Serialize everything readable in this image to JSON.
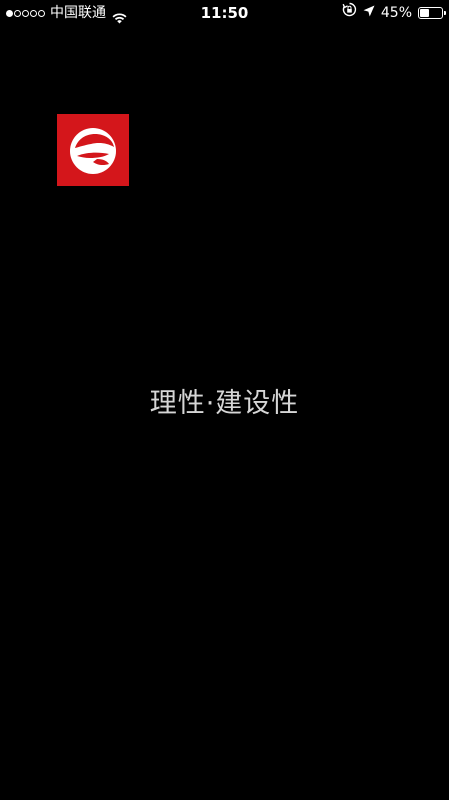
{
  "status_bar": {
    "signal_dots_filled": 1,
    "signal_dots_total": 5,
    "carrier": "中国联通",
    "time": "11:50",
    "battery_percent": "45%",
    "battery_level": 0.45,
    "icons": [
      "wifi-icon",
      "rotation-lock-icon",
      "location-icon",
      "battery-icon"
    ]
  },
  "splash": {
    "logo_icon": "app-logo-e-icon",
    "slogan": "理性·建设性"
  },
  "colors": {
    "background": "#000000",
    "logo_red": "#d4161b",
    "slogan_text": "#d6d6d6"
  }
}
